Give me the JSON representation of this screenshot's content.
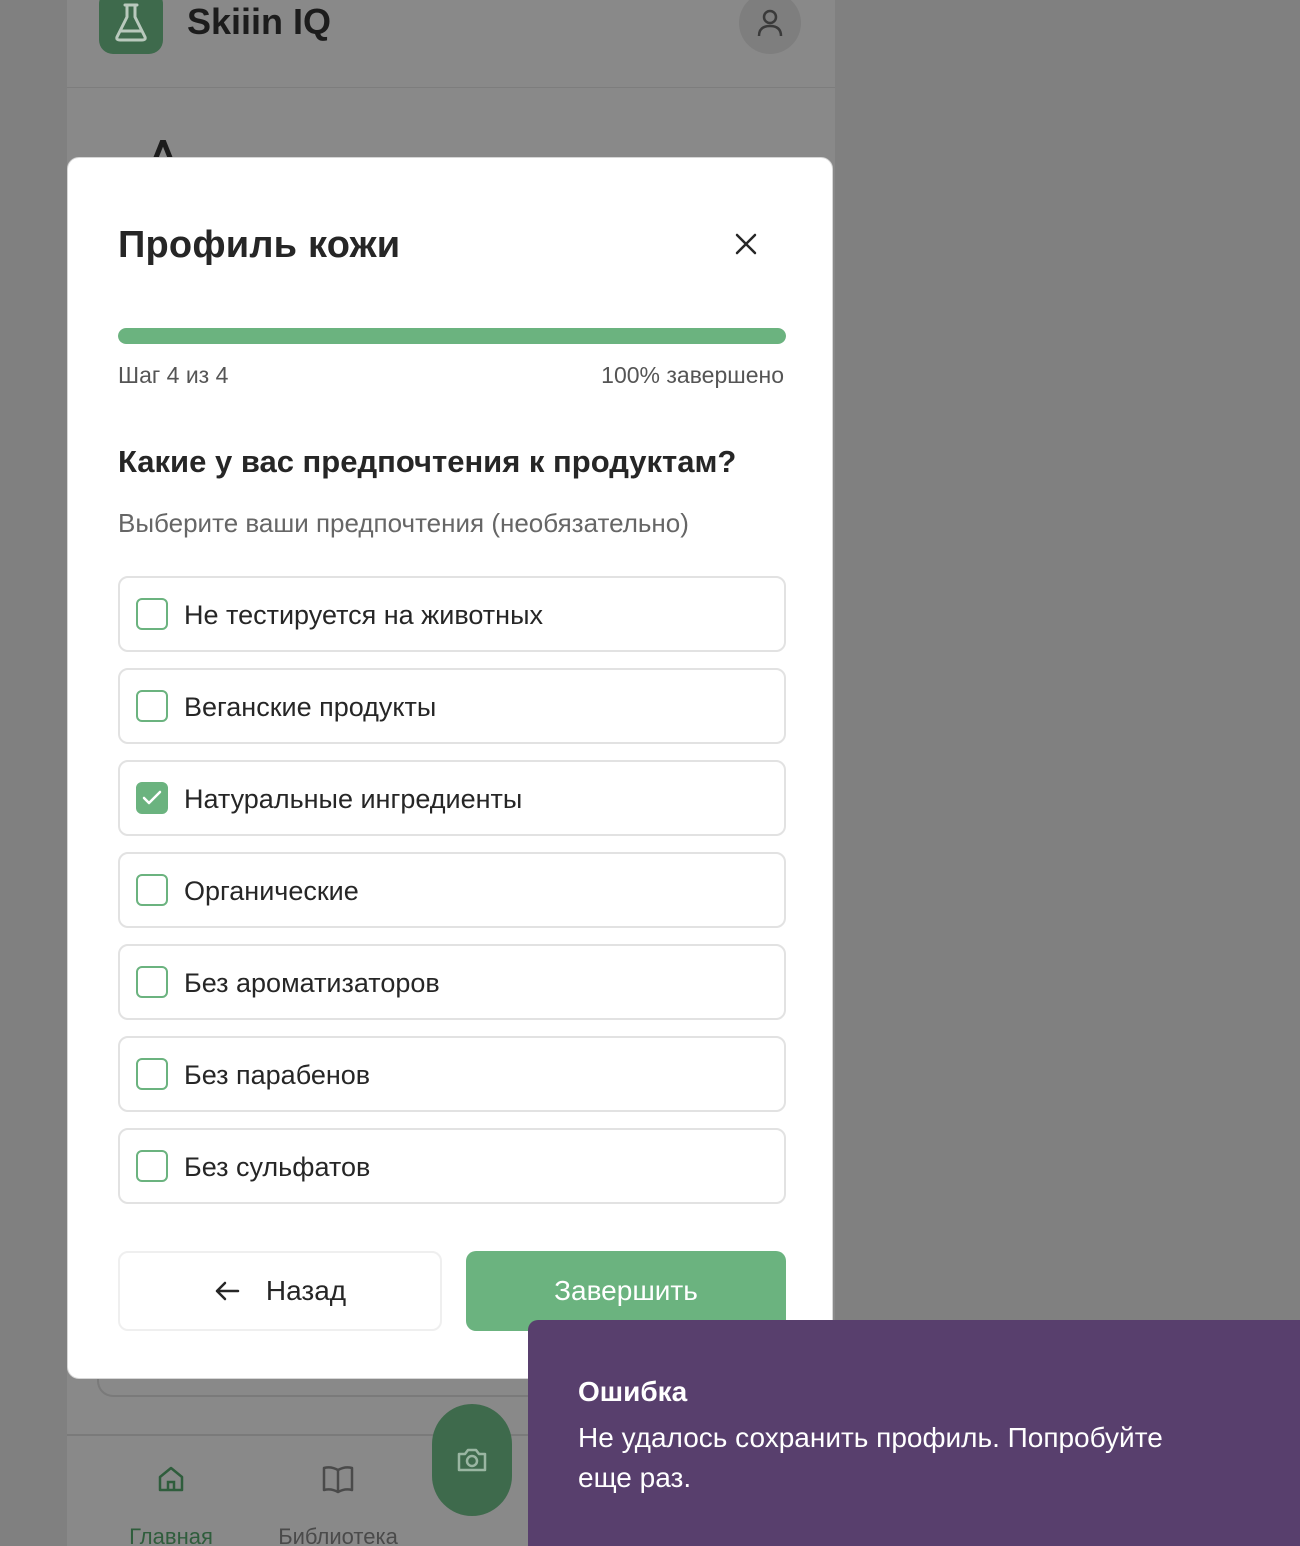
{
  "app": {
    "title": "Skiiin IQ"
  },
  "bottom_nav": {
    "items": [
      {
        "label": "Главная",
        "icon": "home-icon",
        "active": true
      },
      {
        "label": "Библиотека",
        "icon": "book-icon",
        "active": false
      }
    ],
    "fab_icon": "camera-icon"
  },
  "modal": {
    "title": "Профиль кожи",
    "progress_fraction": 1.0,
    "step_label": "Шаг 4 из 4",
    "percent_label": "100% завершено",
    "question": "Какие у вас предпочтения к продуктам?",
    "hint": "Выберите ваши предпочтения (необязательно)",
    "options": [
      {
        "label": "Не тестируется на животных",
        "checked": false
      },
      {
        "label": "Веганские продукты",
        "checked": false
      },
      {
        "label": "Натуральные ингредиенты",
        "checked": true
      },
      {
        "label": "Органические",
        "checked": false
      },
      {
        "label": "Без ароматизаторов",
        "checked": false
      },
      {
        "label": "Без парабенов",
        "checked": false
      },
      {
        "label": "Без сульфатов",
        "checked": false
      }
    ],
    "back_label": "Назад",
    "finish_label": "Завершить"
  },
  "toast": {
    "title": "Ошибка",
    "message": "Не удалось сохранить профиль. Попробуйте еще раз."
  },
  "colors": {
    "accent": "#6bb37f",
    "toast_bg": "#583f6d",
    "overlay": "#808080"
  }
}
